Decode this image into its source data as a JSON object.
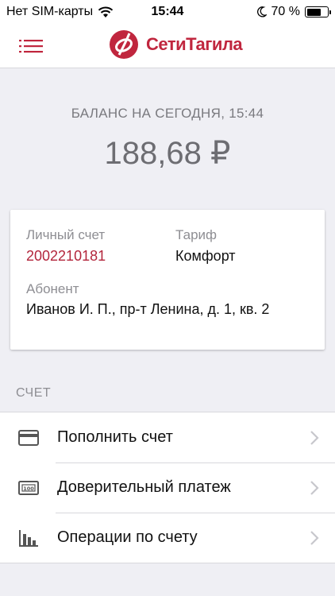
{
  "status_bar": {
    "carrier": "Нет SIM-карты",
    "time": "15:44",
    "battery_percent": "70 %",
    "battery_level": 0.7
  },
  "header": {
    "menu_icon": "hamburger-icon",
    "logo_text": "СетиТагила",
    "brand_color": "#c0263e"
  },
  "balance": {
    "title": "БАЛАНС НА СЕГОДНЯ, 15:44",
    "value": "188,68 ₽"
  },
  "account_card": {
    "account_label": "Личный счет",
    "account_number": "2002210181",
    "tariff_label": "Тариф",
    "tariff_value": "Комфорт",
    "subscriber_label": "Абонент",
    "subscriber_value": "Иванов И. П., пр-т Ленина, д. 1, кв. 2"
  },
  "account_section": {
    "title": "СЧЕТ",
    "items": [
      {
        "label": "Пополнить счет",
        "icon": "credit-card-icon"
      },
      {
        "label": "Доверительный платеж",
        "icon": "banknote-icon"
      },
      {
        "label": "Операции по счету",
        "icon": "bar-chart-icon"
      }
    ]
  }
}
